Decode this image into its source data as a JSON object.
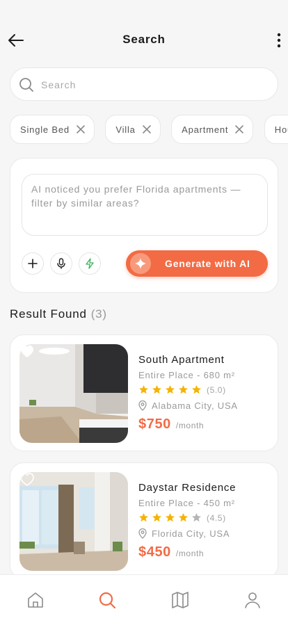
{
  "header": {
    "title": "Search"
  },
  "search": {
    "placeholder": "Search",
    "value": ""
  },
  "filters": [
    {
      "label": "Single Bed"
    },
    {
      "label": "Villa"
    },
    {
      "label": "Apartment"
    },
    {
      "label": "Hou"
    }
  ],
  "ai": {
    "prompt_text": "AI noticed you prefer Florida apartments — filter by similar areas?",
    "generate_label": "Generate with AI",
    "accent_color": "#f26b45"
  },
  "results": {
    "label": "Result Found",
    "count": "(3)",
    "items": [
      {
        "name": "South Apartment",
        "meta": "Entire Place - 680 m²",
        "stars": 5,
        "rating": "(5.0)",
        "location": "Alabama City, USA",
        "price": "$750",
        "period": "/month",
        "favorited": true
      },
      {
        "name": "Daystar Residence",
        "meta": "Entire Place - 450 m²",
        "stars": 4,
        "rating": "(4.5)",
        "location": "Florida City, USA",
        "price": "$450",
        "period": "/month",
        "favorited": false
      }
    ]
  },
  "tabbar": {
    "items": [
      {
        "icon": "home-icon",
        "active": false
      },
      {
        "icon": "search-icon",
        "active": true
      },
      {
        "icon": "map-icon",
        "active": false
      },
      {
        "icon": "profile-icon",
        "active": false
      }
    ]
  }
}
